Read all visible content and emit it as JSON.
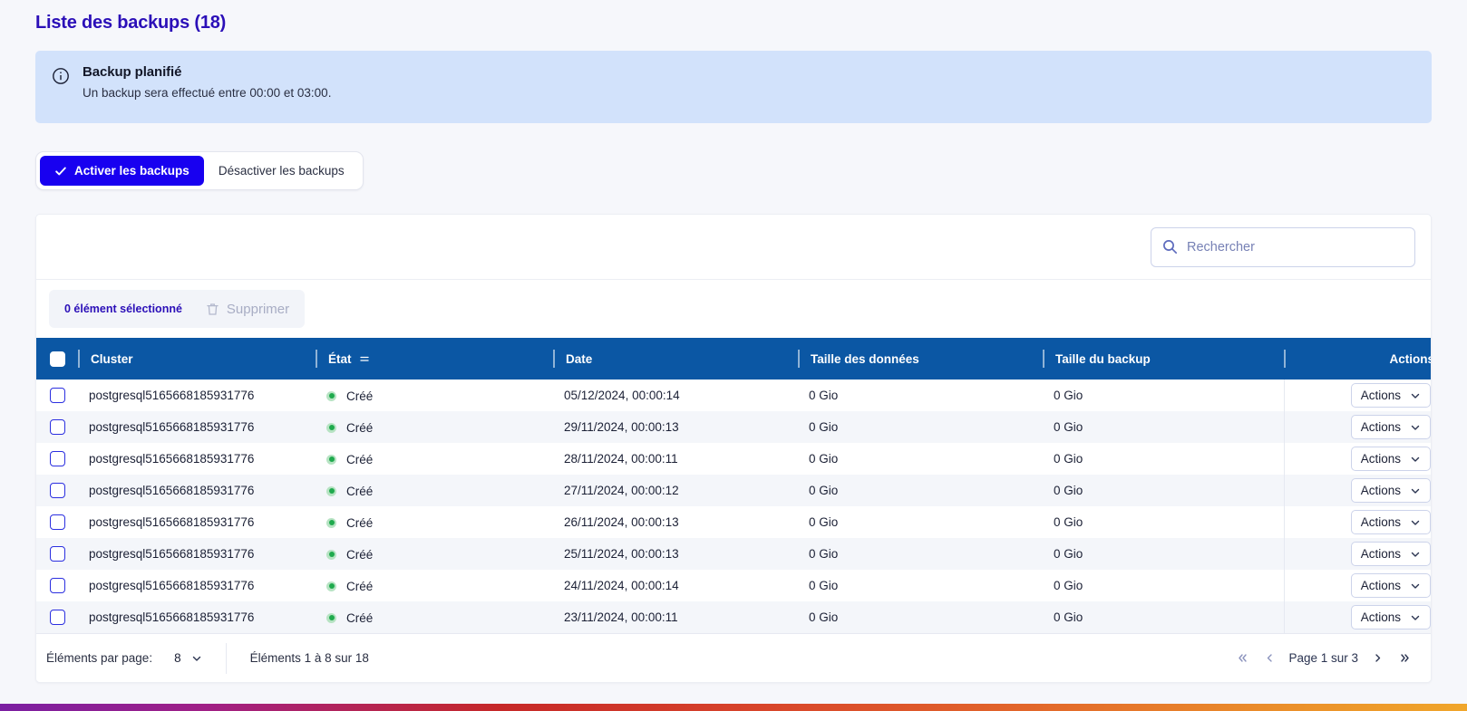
{
  "page": {
    "title": "Liste des backups (18)",
    "title_color": "#2b0fb8"
  },
  "banner": {
    "icon": "info-circle-icon",
    "title": "Backup planifié",
    "text": "Un backup sera effectué entre 00:00 et 03:00.",
    "bg_color": "#d2e2fb"
  },
  "toggle": {
    "enable_label": "Activer les backups",
    "disable_label": "Désactiver les backups",
    "active": "enable",
    "active_color": "#1800f0",
    "check_icon": "check-icon"
  },
  "search": {
    "placeholder": "Rechercher",
    "value": "",
    "icon": "search-icon"
  },
  "selection": {
    "count_label": "0 élément sélectionné",
    "delete_label": "Supprimer",
    "delete_icon": "trash-icon",
    "delete_disabled": true
  },
  "table": {
    "header_bg": "#0b57a4",
    "columns": [
      {
        "key": "check",
        "label": ""
      },
      {
        "key": "cluster",
        "label": "Cluster"
      },
      {
        "key": "etat",
        "label": "État",
        "sortable": true,
        "sort_icon": "sort-icon"
      },
      {
        "key": "date",
        "label": "Date"
      },
      {
        "key": "data_size",
        "label": "Taille des données"
      },
      {
        "key": "backup_size",
        "label": "Taille du backup"
      },
      {
        "key": "actions",
        "label": "Actions"
      }
    ],
    "row_action_label": "Actions",
    "row_action_icon": "chevron-down-icon",
    "status_color": "#1faa4d",
    "rows": [
      {
        "cluster": "postgresql5165668185931776",
        "etat": "Créé",
        "date": "05/12/2024, 00:00:14",
        "data_size": "0 Gio",
        "backup_size": "0 Gio",
        "selected": false
      },
      {
        "cluster": "postgresql5165668185931776",
        "etat": "Créé",
        "date": "29/11/2024, 00:00:13",
        "data_size": "0 Gio",
        "backup_size": "0 Gio",
        "selected": false
      },
      {
        "cluster": "postgresql5165668185931776",
        "etat": "Créé",
        "date": "28/11/2024, 00:00:11",
        "data_size": "0 Gio",
        "backup_size": "0 Gio",
        "selected": false
      },
      {
        "cluster": "postgresql5165668185931776",
        "etat": "Créé",
        "date": "27/11/2024, 00:00:12",
        "data_size": "0 Gio",
        "backup_size": "0 Gio",
        "selected": false
      },
      {
        "cluster": "postgresql5165668185931776",
        "etat": "Créé",
        "date": "26/11/2024, 00:00:13",
        "data_size": "0 Gio",
        "backup_size": "0 Gio",
        "selected": false
      },
      {
        "cluster": "postgresql5165668185931776",
        "etat": "Créé",
        "date": "25/11/2024, 00:00:13",
        "data_size": "0 Gio",
        "backup_size": "0 Gio",
        "selected": false
      },
      {
        "cluster": "postgresql5165668185931776",
        "etat": "Créé",
        "date": "24/11/2024, 00:00:14",
        "data_size": "0 Gio",
        "backup_size": "0 Gio",
        "selected": false
      },
      {
        "cluster": "postgresql5165668185931776",
        "etat": "Créé",
        "date": "23/11/2024, 00:00:11",
        "data_size": "0 Gio",
        "backup_size": "0 Gio",
        "selected": false
      }
    ]
  },
  "footer": {
    "per_page_label": "Éléments par page:",
    "per_page_value": "8",
    "per_page_icon": "chevron-down-icon",
    "range_label": "Éléments 1 à 8 sur 18",
    "page_label": "Page 1 sur 3",
    "first_icon": "chevron-double-left-icon",
    "prev_icon": "chevron-left-icon",
    "next_icon": "chevron-right-icon",
    "last_icon": "chevron-double-right-icon"
  }
}
